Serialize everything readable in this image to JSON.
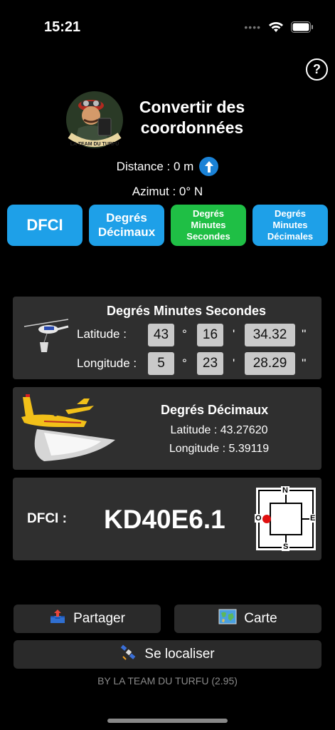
{
  "status_bar": {
    "time": "15:21",
    "dots": "••••"
  },
  "help": {
    "label": "?"
  },
  "header": {
    "title_line1": "Convertir des",
    "title_line2": "coordonnées",
    "logo_text": "LA TEAM DU TURFU"
  },
  "distance": {
    "label": "Distance : 0 m"
  },
  "azimut": {
    "label": "Azimut : 0° N"
  },
  "modes": {
    "dfci": "DFCI",
    "dd_line1": "Degrés",
    "dd_line2": "Décimaux",
    "dms_line1": "Degrés",
    "dms_line2": "Minutes",
    "dms_line3": "Secondes",
    "dmd_line1": "Degrés",
    "dmd_line2": "Minutes",
    "dmd_line3": "Décimales"
  },
  "dms_card": {
    "title": "Degrés Minutes Secondes",
    "latitude_label": "Latitude :",
    "longitude_label": "Longitude :",
    "lat": {
      "deg": "43",
      "min": "16",
      "sec": "34.32"
    },
    "lon": {
      "deg": "5",
      "min": "23",
      "sec": "28.29"
    },
    "deg_sym": "°",
    "min_sym": "'",
    "sec_sym": "''"
  },
  "dd_card": {
    "title": "Degrés Décimaux",
    "latitude": "Latitude : 43.27620",
    "longitude": "Longitude : 5.39119"
  },
  "dfci_card": {
    "label": "DFCI :",
    "code": "KD40E6.1",
    "compass": {
      "n": "N",
      "s": "S",
      "e": "E",
      "o": "O"
    }
  },
  "actions": {
    "share": "Partager",
    "map": "Carte",
    "locate": "Se localiser"
  },
  "footer": "BY LA TEAM DU TURFU (2.95)",
  "colors": {
    "blue": "#1ea0e8",
    "green": "#1fbf45",
    "card": "#2f2f2f",
    "marker": "#e01010"
  }
}
